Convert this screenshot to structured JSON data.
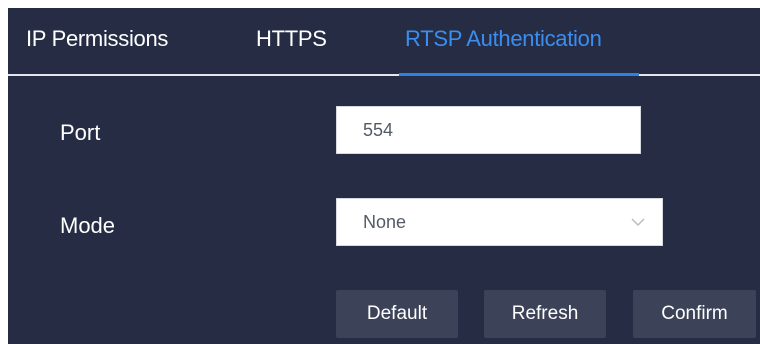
{
  "tabs": {
    "ip_permissions": "IP Permissions",
    "https": "HTTPS",
    "rtsp_authentication": "RTSP Authentication",
    "active": "RTSP Authentication"
  },
  "form": {
    "port_label": "Port",
    "port_value": "554",
    "mode_label": "Mode",
    "mode_value": "None",
    "mode_icon": "chevron-down-icon"
  },
  "buttons": {
    "default": "Default",
    "refresh": "Refresh",
    "confirm": "Confirm"
  },
  "colors": {
    "panel_background": "#262c44",
    "accent": "#3a8ef0",
    "button_background": "#3c4258"
  }
}
